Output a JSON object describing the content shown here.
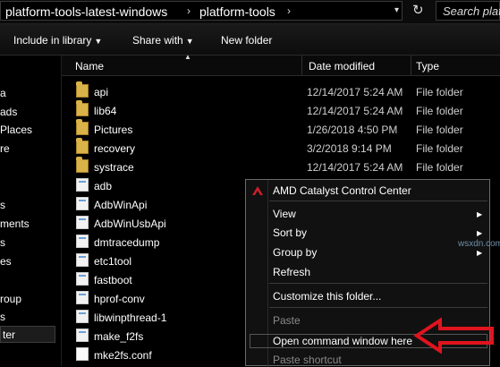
{
  "addressbar": {
    "crumbs": [
      "platform-tools-latest-windows",
      "platform-tools"
    ],
    "separator": "›",
    "dropdown_glyph": "▾",
    "refresh_glyph": "↻",
    "search_placeholder": "Search platf"
  },
  "toolbar": {
    "include_label": "Include in library",
    "share_label": "Share with",
    "newfolder_label": "New folder",
    "caret": "▼"
  },
  "nav": {
    "items": [
      "a",
      "ads",
      "Places",
      "re",
      "s",
      "ments",
      "s",
      "es",
      "roup",
      "s",
      "ter"
    ]
  },
  "columns": {
    "name": "Name",
    "date": "Date modified",
    "type": "Type",
    "sort_glyph": "▲"
  },
  "files": [
    {
      "name": "api",
      "date": "12/14/2017 5:24 AM",
      "type": "File folder",
      "icon": "folder-icon"
    },
    {
      "name": "lib64",
      "date": "12/14/2017 5:24 AM",
      "type": "File folder",
      "icon": "folder-icon"
    },
    {
      "name": "Pictures",
      "date": "1/26/2018 4:50 PM",
      "type": "File folder",
      "icon": "folder-icon"
    },
    {
      "name": "recovery",
      "date": "3/2/2018 9:14 PM",
      "type": "File folder",
      "icon": "folder-icon"
    },
    {
      "name": "systrace",
      "date": "12/14/2017 5:24 AM",
      "type": "File folder",
      "icon": "folder-icon"
    },
    {
      "name": "adb",
      "date": "",
      "type": "",
      "icon": "exe-icon"
    },
    {
      "name": "AdbWinApi",
      "date": "",
      "type": "",
      "icon": "exe-icon"
    },
    {
      "name": "AdbWinUsbApi",
      "date": "",
      "type": "",
      "icon": "exe-icon"
    },
    {
      "name": "dmtracedump",
      "date": "",
      "type": "",
      "icon": "exe-icon"
    },
    {
      "name": "etc1tool",
      "date": "",
      "type": "",
      "icon": "exe-icon"
    },
    {
      "name": "fastboot",
      "date": "",
      "type": "",
      "icon": "exe-icon"
    },
    {
      "name": "hprof-conv",
      "date": "",
      "type": "",
      "icon": "exe-icon"
    },
    {
      "name": "libwinpthread-1",
      "date": "",
      "type": "",
      "icon": "exe-icon"
    },
    {
      "name": "make_f2fs",
      "date": "",
      "type": "",
      "icon": "exe-icon"
    },
    {
      "name": "mke2fs.conf",
      "date": "",
      "type": "",
      "icon": "doc-icon"
    }
  ],
  "context_menu": {
    "amd": "AMD Catalyst Control Center",
    "view": "View",
    "sort_by": "Sort by",
    "group_by": "Group by",
    "refresh": "Refresh",
    "customize": "Customize this folder...",
    "paste": "Paste",
    "open_cmd": "Open command window here",
    "paste_shortcut": "Paste shortcut",
    "submenu_glyph": "▶"
  },
  "watermark": "wsxdn.com",
  "colors": {
    "annotation": "#e0141e",
    "folder": "#d9b348",
    "background": "#000000"
  }
}
